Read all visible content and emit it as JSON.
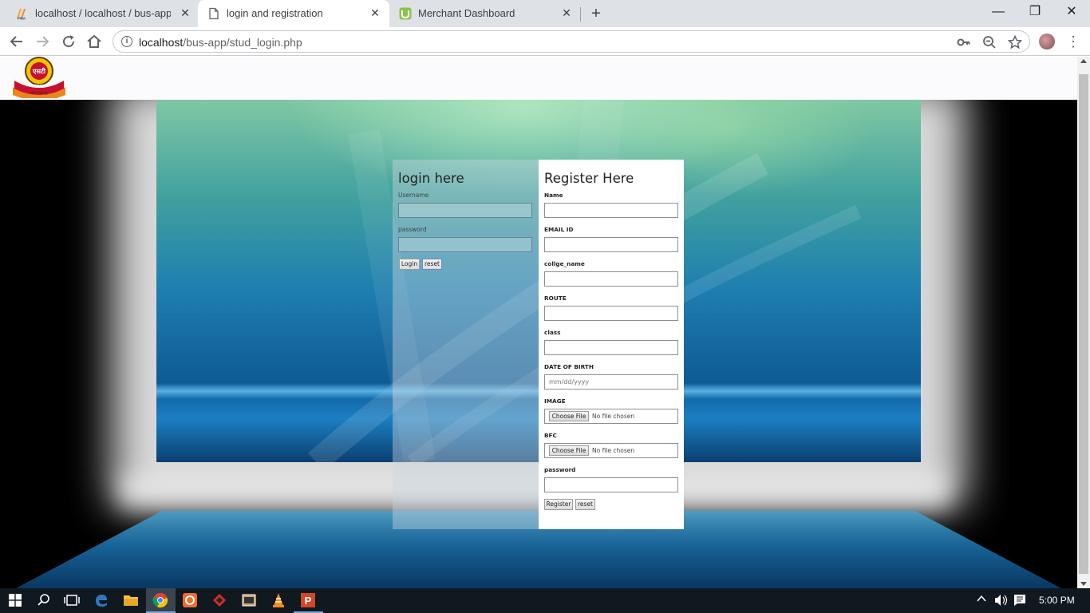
{
  "browser": {
    "tabs": [
      {
        "title": "localhost / localhost / bus-app / l",
        "icon": "phpmyadmin-icon"
      },
      {
        "title": "login and registration",
        "icon": "document-icon",
        "active": true
      },
      {
        "title": "Merchant Dashboard",
        "icon": "merchant-app-icon"
      }
    ],
    "close_glyph": "✕",
    "new_tab_glyph": "+",
    "window": {
      "minimize": "—",
      "maximize": "❐",
      "close": "✕"
    },
    "url_host": "localhost",
    "url_path": "/bus-app/stud_login.php"
  },
  "page": {
    "login": {
      "title": "login here",
      "username_label": "Username",
      "password_label": "password",
      "login_button": "Login",
      "reset_button": "reset"
    },
    "register": {
      "title": "Register Here",
      "fields": {
        "name": "Name",
        "email": "EMAIL ID",
        "college": "collge_name",
        "route": "ROUTE",
        "class": "class",
        "dob": "DATE OF BIRTH",
        "dob_placeholder": "mm/dd/yyyy",
        "image": "IMAGE",
        "bfc": "BFC",
        "password": "password"
      },
      "choose_file": "Choose File",
      "no_file": "No file chosen",
      "register_button": "Register",
      "reset_button": "reset"
    }
  },
  "taskbar": {
    "clock": "5:00 PM"
  },
  "colors": {
    "tabbar": "#dee1e6",
    "taskbar": "#101820",
    "register_bg": "#ffffff"
  }
}
